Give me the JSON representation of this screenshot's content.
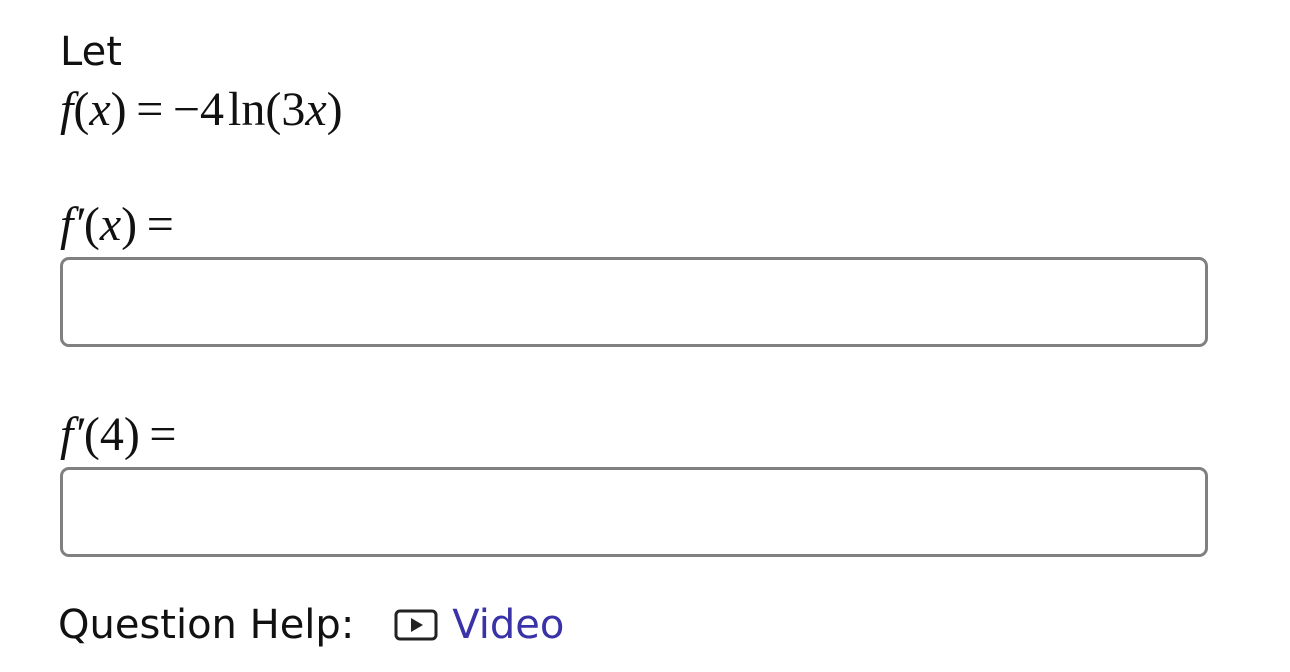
{
  "question": {
    "intro": "Let",
    "function_def": {
      "name": "f",
      "var": "x",
      "equals": "=",
      "rhs_coeff": "−4",
      "rhs_func": "ln",
      "rhs_inner_coeff": "3",
      "rhs_inner_var": "x"
    },
    "parts": [
      {
        "lhs_name": "f′",
        "lhs_arg": "x",
        "equals": "=",
        "answer_value": "",
        "answer_placeholder": ""
      },
      {
        "lhs_name": "f′",
        "lhs_arg": "4",
        "equals": "=",
        "answer_value": "",
        "answer_placeholder": ""
      }
    ]
  },
  "help": {
    "label": "Question Help:",
    "video_icon": "play-video-icon",
    "video_label": "Video"
  },
  "colors": {
    "link": "#3a33a8",
    "input_border": "#808080",
    "text": "#111111"
  }
}
